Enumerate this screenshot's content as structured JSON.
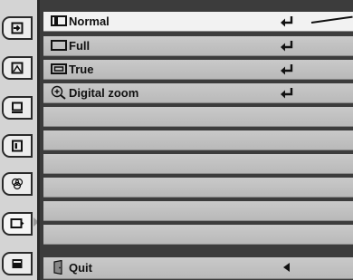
{
  "menu": {
    "items": [
      {
        "label": "Normal",
        "icon": "normal-screen-icon",
        "action": "enter-icon",
        "selected": true
      },
      {
        "label": "Full",
        "icon": "full-screen-icon",
        "action": "enter-icon",
        "selected": false
      },
      {
        "label": "True",
        "icon": "true-screen-icon",
        "action": "enter-icon",
        "selected": false
      },
      {
        "label": "Digital zoom",
        "icon": "magnifier-icon",
        "action": "enter-icon",
        "selected": false
      },
      {
        "label": "",
        "selected": false
      },
      {
        "label": "",
        "selected": false
      },
      {
        "label": "",
        "selected": false
      },
      {
        "label": "",
        "selected": false
      },
      {
        "label": "",
        "selected": false
      },
      {
        "label": "",
        "selected": false
      }
    ],
    "quit": {
      "label": "Quit",
      "icon": "quit-door-icon",
      "action": "left-arrow-icon"
    }
  },
  "tabs": [
    {
      "icon": "input-icon"
    },
    {
      "icon": "image-adjust-icon"
    },
    {
      "icon": "pc-adjust-icon"
    },
    {
      "icon": "image-select-icon"
    },
    {
      "icon": "color-icon"
    },
    {
      "icon": "screen-icon",
      "active": true
    },
    {
      "icon": "setting-icon"
    }
  ],
  "colors": {
    "panel": "#3c3c3c",
    "row": "#c3c3c3",
    "row_selected": "#f2f2f2",
    "text": "#111111"
  }
}
